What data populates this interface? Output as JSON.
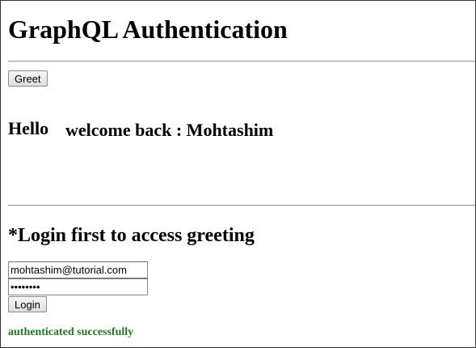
{
  "page": {
    "title": "GraphQL Authentication"
  },
  "greet": {
    "button_label": "Greet",
    "hello_text": "Hello",
    "message": "welcome back : Mohtashim"
  },
  "login": {
    "heading": "*Login first to access greeting",
    "email_value": "mohtashim@tutorial.com",
    "password_value": "pass@123",
    "button_label": "Login",
    "status_message": "authenticated successfully"
  },
  "colors": {
    "status_success": "#1e7a1e"
  }
}
